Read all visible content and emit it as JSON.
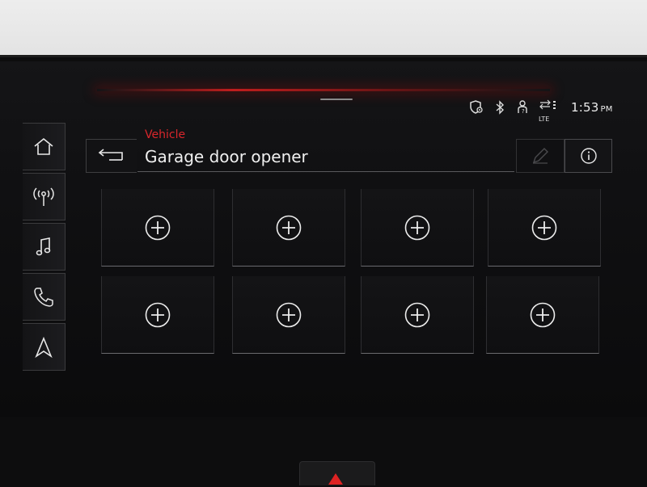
{
  "status_bar": {
    "time": "1:53",
    "ampm": "PM",
    "network": "LTE",
    "icons": [
      "location-shield-icon",
      "bluetooth-icon",
      "user-icon",
      "lte-signal-icon"
    ]
  },
  "sidebar": {
    "items": [
      {
        "icon": "home-icon"
      },
      {
        "icon": "radio-icon"
      },
      {
        "icon": "music-icon"
      },
      {
        "icon": "phone-icon"
      },
      {
        "icon": "navigation-icon"
      }
    ]
  },
  "header": {
    "breadcrumb": "Vehicle",
    "title": "Garage door opener",
    "back_icon": "back-arrow-icon",
    "edit_icon": "pencil-icon",
    "info_icon": "info-icon"
  },
  "slots": {
    "rows": 2,
    "columns": 4,
    "items": [
      {
        "icon": "add-icon"
      },
      {
        "icon": "add-icon"
      },
      {
        "icon": "add-icon"
      },
      {
        "icon": "add-icon"
      },
      {
        "icon": "add-icon"
      },
      {
        "icon": "add-icon"
      },
      {
        "icon": "add-icon"
      },
      {
        "icon": "add-icon"
      }
    ]
  },
  "colors": {
    "accent_red": "#d9262b",
    "background": "#0d0d0e",
    "text": "#f0f0f0"
  }
}
